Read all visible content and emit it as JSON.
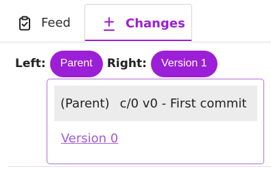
{
  "tabs": {
    "feed": {
      "label": "Feed",
      "icon": "clipboard-check-icon"
    },
    "changes": {
      "label": "Changes",
      "icon": "plus-minus-icon",
      "active": true
    }
  },
  "compare": {
    "left_label": "Left:",
    "left_value": "Parent",
    "right_label": "Right:",
    "right_value": "Version 1"
  },
  "dropdown": {
    "options": [
      {
        "tag": "(Parent)",
        "text": "c/0 v0 - First commit",
        "selected": true
      },
      {
        "text": "Version 0",
        "link": true
      }
    ]
  },
  "colors": {
    "accent": "#9b1fd6",
    "link": "#a259d9",
    "selected_bg": "#ececec"
  }
}
